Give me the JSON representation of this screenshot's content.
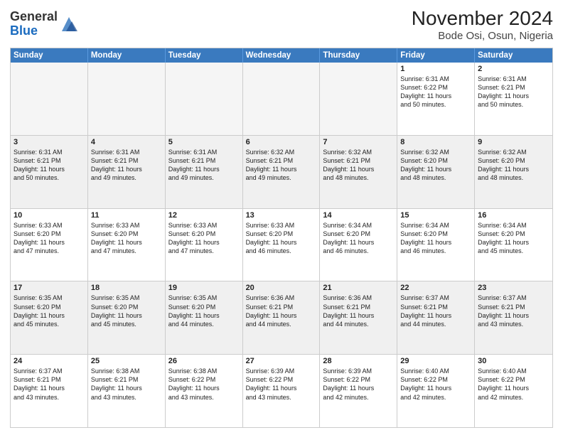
{
  "header": {
    "logo_general": "General",
    "logo_blue": "Blue",
    "month_year": "November 2024",
    "location": "Bode Osi, Osun, Nigeria"
  },
  "weekdays": [
    "Sunday",
    "Monday",
    "Tuesday",
    "Wednesday",
    "Thursday",
    "Friday",
    "Saturday"
  ],
  "rows": [
    [
      {
        "day": "",
        "info": "",
        "empty": true
      },
      {
        "day": "",
        "info": "",
        "empty": true
      },
      {
        "day": "",
        "info": "",
        "empty": true
      },
      {
        "day": "",
        "info": "",
        "empty": true
      },
      {
        "day": "",
        "info": "",
        "empty": true
      },
      {
        "day": "1",
        "info": "Sunrise: 6:31 AM\nSunset: 6:22 PM\nDaylight: 11 hours\nand 50 minutes.",
        "empty": false
      },
      {
        "day": "2",
        "info": "Sunrise: 6:31 AM\nSunset: 6:21 PM\nDaylight: 11 hours\nand 50 minutes.",
        "empty": false
      }
    ],
    [
      {
        "day": "3",
        "info": "Sunrise: 6:31 AM\nSunset: 6:21 PM\nDaylight: 11 hours\nand 50 minutes.",
        "empty": false
      },
      {
        "day": "4",
        "info": "Sunrise: 6:31 AM\nSunset: 6:21 PM\nDaylight: 11 hours\nand 49 minutes.",
        "empty": false
      },
      {
        "day": "5",
        "info": "Sunrise: 6:31 AM\nSunset: 6:21 PM\nDaylight: 11 hours\nand 49 minutes.",
        "empty": false
      },
      {
        "day": "6",
        "info": "Sunrise: 6:32 AM\nSunset: 6:21 PM\nDaylight: 11 hours\nand 49 minutes.",
        "empty": false
      },
      {
        "day": "7",
        "info": "Sunrise: 6:32 AM\nSunset: 6:21 PM\nDaylight: 11 hours\nand 48 minutes.",
        "empty": false
      },
      {
        "day": "8",
        "info": "Sunrise: 6:32 AM\nSunset: 6:20 PM\nDaylight: 11 hours\nand 48 minutes.",
        "empty": false
      },
      {
        "day": "9",
        "info": "Sunrise: 6:32 AM\nSunset: 6:20 PM\nDaylight: 11 hours\nand 48 minutes.",
        "empty": false
      }
    ],
    [
      {
        "day": "10",
        "info": "Sunrise: 6:33 AM\nSunset: 6:20 PM\nDaylight: 11 hours\nand 47 minutes.",
        "empty": false
      },
      {
        "day": "11",
        "info": "Sunrise: 6:33 AM\nSunset: 6:20 PM\nDaylight: 11 hours\nand 47 minutes.",
        "empty": false
      },
      {
        "day": "12",
        "info": "Sunrise: 6:33 AM\nSunset: 6:20 PM\nDaylight: 11 hours\nand 47 minutes.",
        "empty": false
      },
      {
        "day": "13",
        "info": "Sunrise: 6:33 AM\nSunset: 6:20 PM\nDaylight: 11 hours\nand 46 minutes.",
        "empty": false
      },
      {
        "day": "14",
        "info": "Sunrise: 6:34 AM\nSunset: 6:20 PM\nDaylight: 11 hours\nand 46 minutes.",
        "empty": false
      },
      {
        "day": "15",
        "info": "Sunrise: 6:34 AM\nSunset: 6:20 PM\nDaylight: 11 hours\nand 46 minutes.",
        "empty": false
      },
      {
        "day": "16",
        "info": "Sunrise: 6:34 AM\nSunset: 6:20 PM\nDaylight: 11 hours\nand 45 minutes.",
        "empty": false
      }
    ],
    [
      {
        "day": "17",
        "info": "Sunrise: 6:35 AM\nSunset: 6:20 PM\nDaylight: 11 hours\nand 45 minutes.",
        "empty": false
      },
      {
        "day": "18",
        "info": "Sunrise: 6:35 AM\nSunset: 6:20 PM\nDaylight: 11 hours\nand 45 minutes.",
        "empty": false
      },
      {
        "day": "19",
        "info": "Sunrise: 6:35 AM\nSunset: 6:20 PM\nDaylight: 11 hours\nand 44 minutes.",
        "empty": false
      },
      {
        "day": "20",
        "info": "Sunrise: 6:36 AM\nSunset: 6:21 PM\nDaylight: 11 hours\nand 44 minutes.",
        "empty": false
      },
      {
        "day": "21",
        "info": "Sunrise: 6:36 AM\nSunset: 6:21 PM\nDaylight: 11 hours\nand 44 minutes.",
        "empty": false
      },
      {
        "day": "22",
        "info": "Sunrise: 6:37 AM\nSunset: 6:21 PM\nDaylight: 11 hours\nand 44 minutes.",
        "empty": false
      },
      {
        "day": "23",
        "info": "Sunrise: 6:37 AM\nSunset: 6:21 PM\nDaylight: 11 hours\nand 43 minutes.",
        "empty": false
      }
    ],
    [
      {
        "day": "24",
        "info": "Sunrise: 6:37 AM\nSunset: 6:21 PM\nDaylight: 11 hours\nand 43 minutes.",
        "empty": false
      },
      {
        "day": "25",
        "info": "Sunrise: 6:38 AM\nSunset: 6:21 PM\nDaylight: 11 hours\nand 43 minutes.",
        "empty": false
      },
      {
        "day": "26",
        "info": "Sunrise: 6:38 AM\nSunset: 6:22 PM\nDaylight: 11 hours\nand 43 minutes.",
        "empty": false
      },
      {
        "day": "27",
        "info": "Sunrise: 6:39 AM\nSunset: 6:22 PM\nDaylight: 11 hours\nand 43 minutes.",
        "empty": false
      },
      {
        "day": "28",
        "info": "Sunrise: 6:39 AM\nSunset: 6:22 PM\nDaylight: 11 hours\nand 42 minutes.",
        "empty": false
      },
      {
        "day": "29",
        "info": "Sunrise: 6:40 AM\nSunset: 6:22 PM\nDaylight: 11 hours\nand 42 minutes.",
        "empty": false
      },
      {
        "day": "30",
        "info": "Sunrise: 6:40 AM\nSunset: 6:22 PM\nDaylight: 11 hours\nand 42 minutes.",
        "empty": false
      }
    ]
  ]
}
